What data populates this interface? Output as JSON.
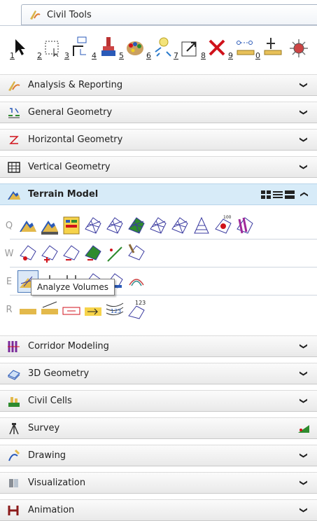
{
  "tab": {
    "label": "Civil Tools"
  },
  "global_tools": [
    {
      "num": "1",
      "icon": "select-arrow-icon"
    },
    {
      "num": "2",
      "icon": "dashed-selection-icon"
    },
    {
      "num": "3",
      "icon": "element-info-icon"
    },
    {
      "num": "4",
      "icon": "paint-attributes-icon"
    },
    {
      "num": "5",
      "icon": "palette-icon"
    },
    {
      "num": "6",
      "icon": "highlight-sparkle-icon"
    },
    {
      "num": "7",
      "icon": "fit-view-icon"
    },
    {
      "num": "8",
      "icon": "delete-icon"
    },
    {
      "num": "9",
      "icon": "measure-distance-icon"
    },
    {
      "num": "0",
      "icon": "measure-angle-icon"
    },
    {
      "num": "",
      "icon": "tool-settings-icon"
    }
  ],
  "sections": {
    "analysis": "Analysis & Reporting",
    "general_geometry": "General Geometry",
    "horizontal_geometry": "Horizontal Geometry",
    "vertical_geometry": "Vertical Geometry",
    "terrain_model": "Terrain Model",
    "corridor_modeling": "Corridor Modeling",
    "geometry_3d": "3D Geometry",
    "civil_cells": "Civil Cells",
    "survey": "Survey",
    "drawing": "Drawing",
    "visualization": "Visualization",
    "animation": "Animation"
  },
  "terrain_rows": {
    "q": "Q",
    "w": "W",
    "e": "E",
    "r": "R"
  },
  "tooltip": "Analyze Volumes",
  "colors": {
    "open_section_bg": "#d7ebf8",
    "terrain_mesh": "#3b3ba0",
    "terrain_fill": "#2e8b2e",
    "accent_red": "#d0121b"
  }
}
